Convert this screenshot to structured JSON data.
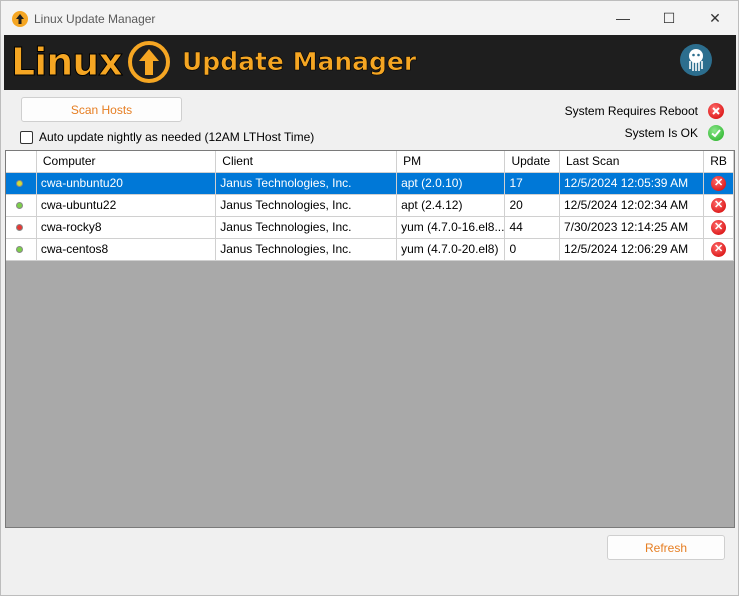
{
  "window": {
    "title": "Linux Update Manager",
    "controls": {
      "minimize": "—",
      "maximize": "☐",
      "close": "✕"
    }
  },
  "banner": {
    "brand": "Linux",
    "product": "Update Manager",
    "logo_icon": "up-arrow-circle-icon",
    "badge_icon": "octopus-logo-icon"
  },
  "toolbar": {
    "scan_label": "Scan Hosts",
    "auto_update_label": "Auto update nightly as needed (12AM LTHost Time)",
    "auto_update_checked": false
  },
  "legend": {
    "reboot_label": "System Requires Reboot",
    "ok_label": "System Is OK"
  },
  "grid": {
    "columns": [
      "",
      "Computer",
      "Client",
      "PM",
      "Update",
      "Last Scan",
      "RB"
    ],
    "rows": [
      {
        "status": "yellow",
        "computer": "cwa-unbuntu20",
        "client": "Janus Technologies, Inc.",
        "pm": "apt (2.0.10)",
        "update": "17",
        "last_scan": "12/5/2024 12:05:39 AM",
        "rb": "reboot",
        "selected": true
      },
      {
        "status": "green",
        "computer": "cwa-ubuntu22",
        "client": "Janus Technologies, Inc.",
        "pm": "apt (2.4.12)",
        "update": "20",
        "last_scan": "12/5/2024 12:02:34 AM",
        "rb": "reboot",
        "selected": false
      },
      {
        "status": "red",
        "computer": "cwa-rocky8",
        "client": "Janus Technologies, Inc.",
        "pm": "yum (4.7.0-16.el8...",
        "update": "44",
        "last_scan": "7/30/2023 12:14:25 AM",
        "rb": "reboot",
        "selected": false
      },
      {
        "status": "green",
        "computer": "cwa-centos8",
        "client": "Janus Technologies, Inc.",
        "pm": "yum (4.7.0-20.el8)",
        "update": "0",
        "last_scan": "12/5/2024 12:06:29 AM",
        "rb": "reboot",
        "selected": false
      }
    ]
  },
  "footer": {
    "refresh_label": "Refresh"
  },
  "colors": {
    "accent": "#f5a623",
    "selection": "#0078d7",
    "grid_empty": "#a9a9a9"
  }
}
